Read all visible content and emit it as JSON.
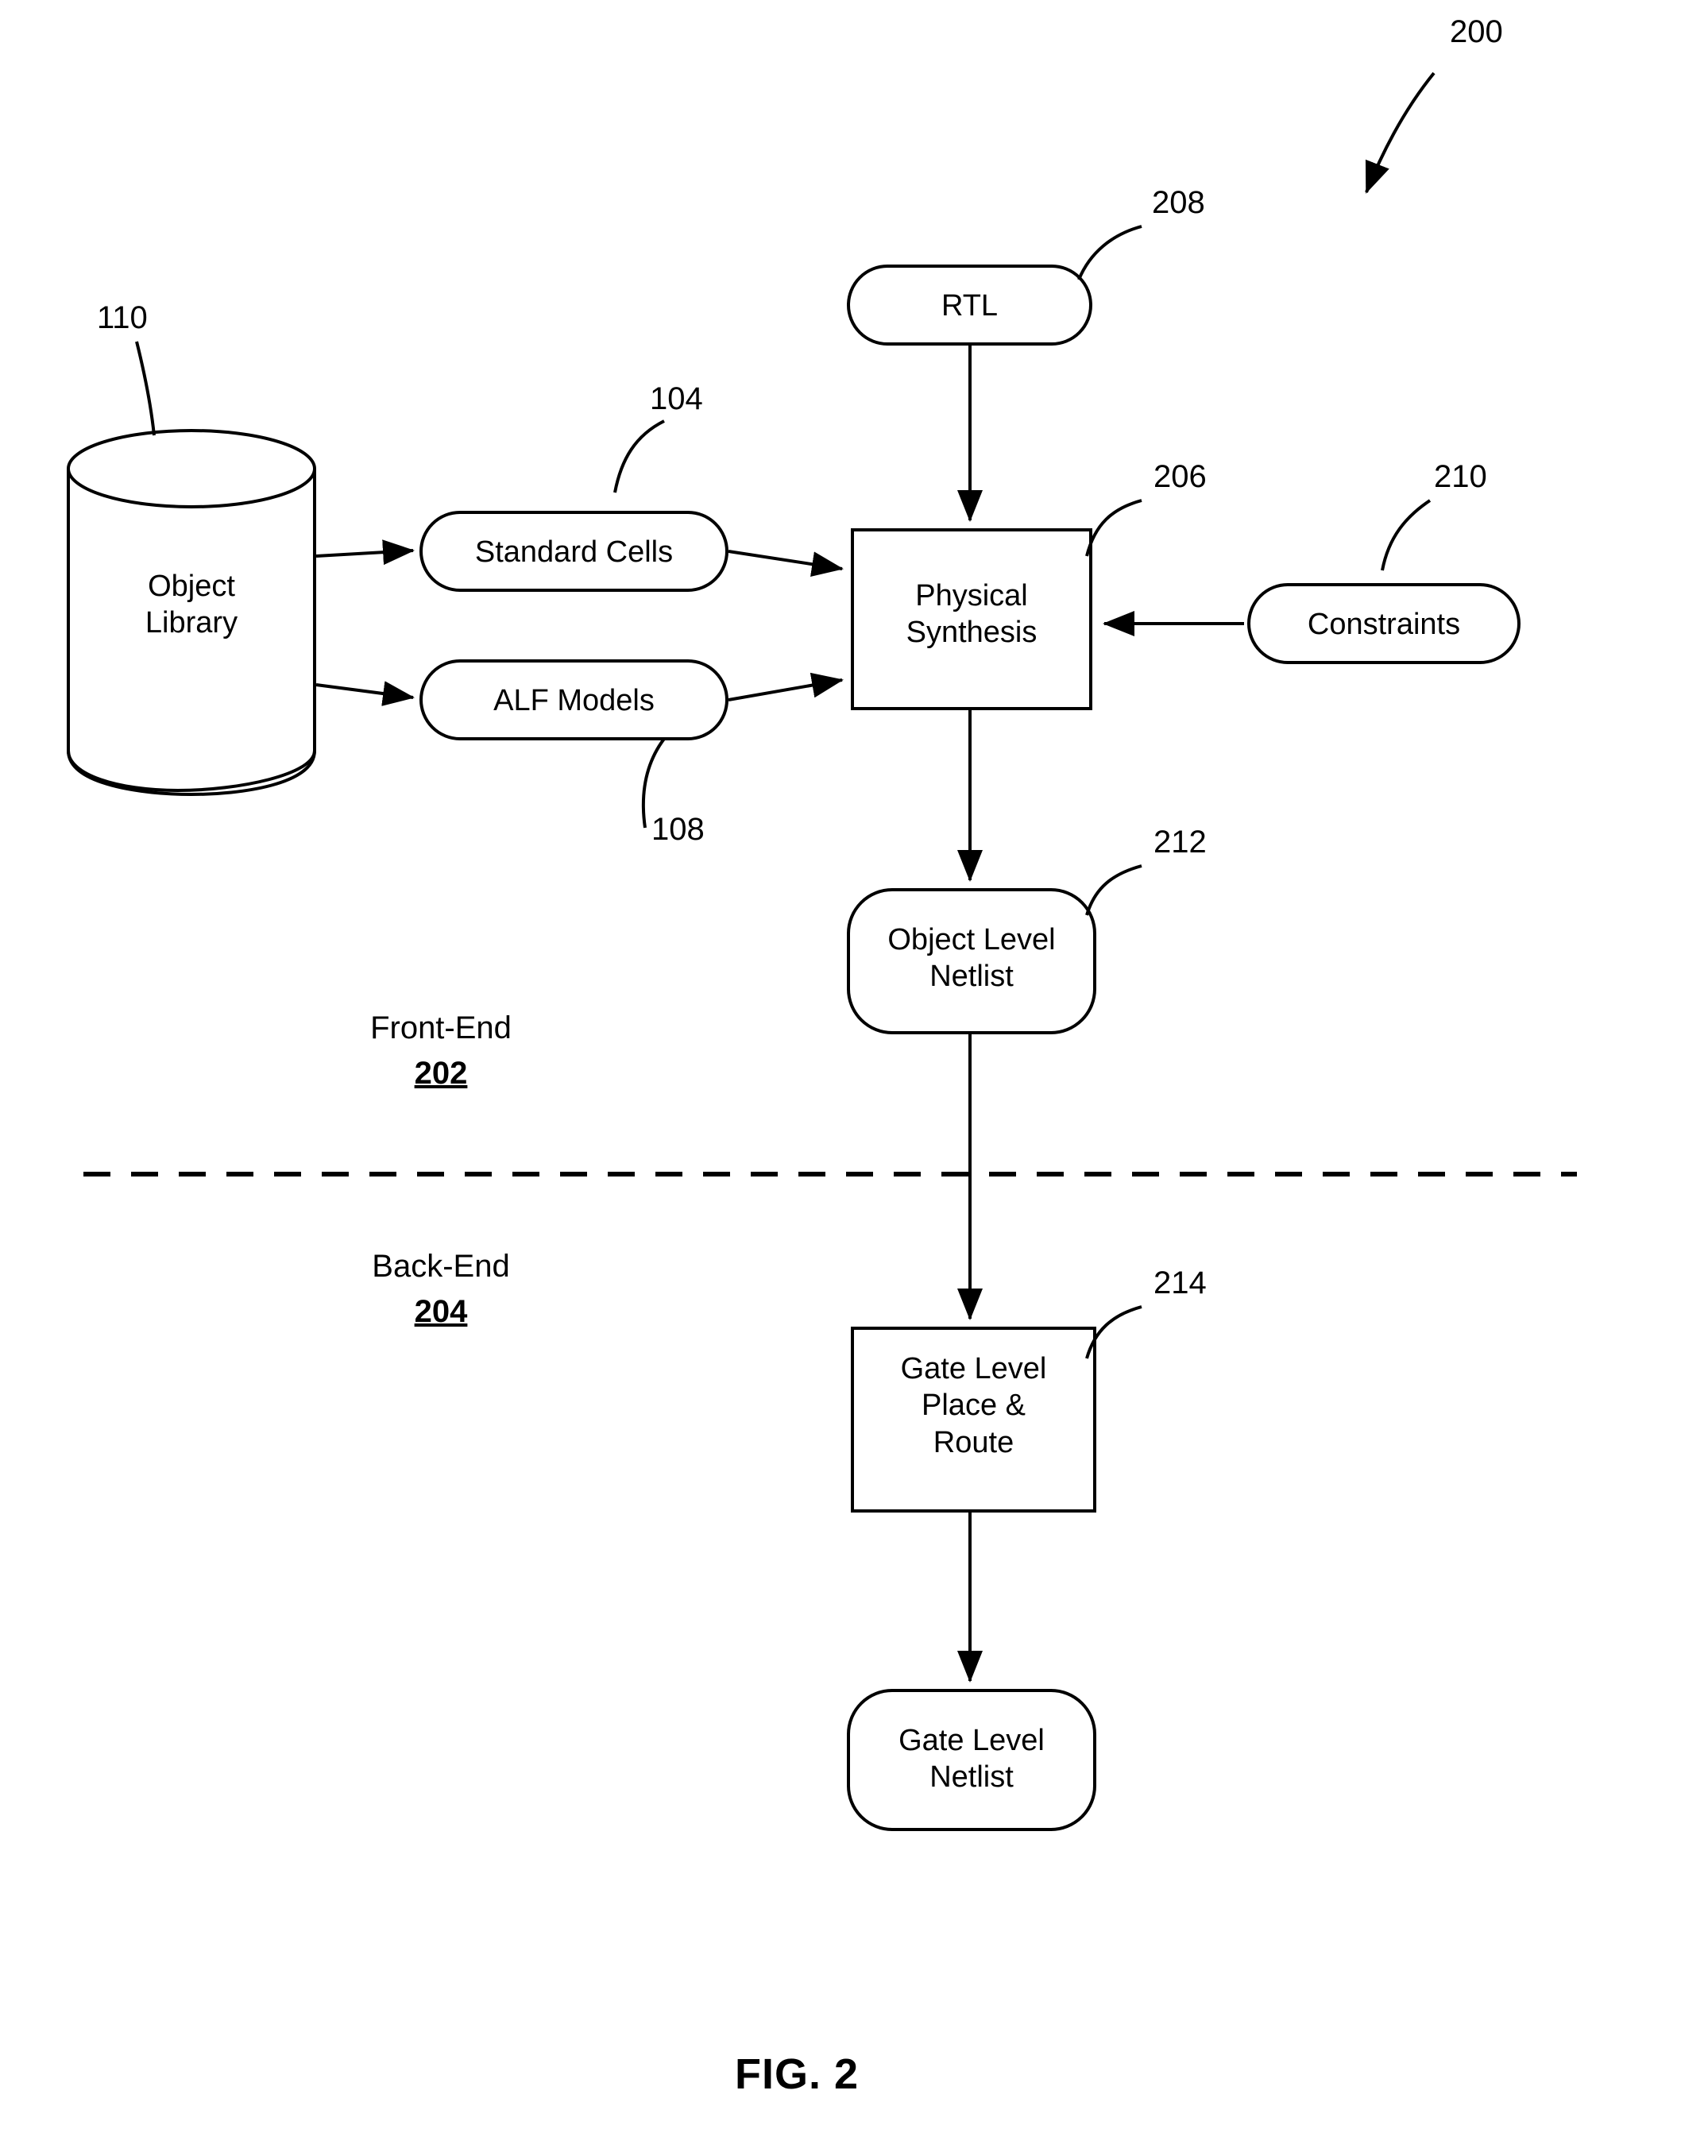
{
  "figure": {
    "caption": "FIG. 2",
    "diagram_number": "200"
  },
  "nodes": [
    {
      "id": "object-library",
      "label": "Object\nLibrary",
      "shape": "cylinder",
      "ref": "110"
    },
    {
      "id": "standard-cells",
      "label": "Standard Cells",
      "shape": "rounded",
      "ref": "104"
    },
    {
      "id": "alf-models",
      "label": "ALF Models",
      "shape": "rounded",
      "ref": "108"
    },
    {
      "id": "rtl",
      "label": "RTL",
      "shape": "rounded",
      "ref": "208"
    },
    {
      "id": "physical-synthesis",
      "label": "Physical\nSynthesis",
      "shape": "rect",
      "ref": "206"
    },
    {
      "id": "constraints",
      "label": "Constraints",
      "shape": "rounded",
      "ref": "210"
    },
    {
      "id": "object-level-netlist",
      "label": "Object Level\nNetlist",
      "shape": "rounded",
      "ref": "212"
    },
    {
      "id": "gate-level-place-route",
      "label": "Gate Level\nPlace &\nRoute",
      "shape": "rect",
      "ref": "214"
    },
    {
      "id": "gate-level-netlist",
      "label": "Gate Level\nNetlist",
      "shape": "rounded",
      "ref": ""
    }
  ],
  "sections": [
    {
      "id": "front-end",
      "name": "Front-End",
      "number": "202"
    },
    {
      "id": "back-end",
      "name": "Back-End",
      "number": "204"
    }
  ],
  "refs": {
    "diagram": "200",
    "object_library": "110",
    "standard_cells": "104",
    "alf_models": "108",
    "rtl": "208",
    "physical_synthesis": "206",
    "constraints": "210",
    "object_level_netlist": "212",
    "gate_level_place_route": "214"
  },
  "colors": {
    "stroke": "#000000",
    "background": "#ffffff"
  }
}
